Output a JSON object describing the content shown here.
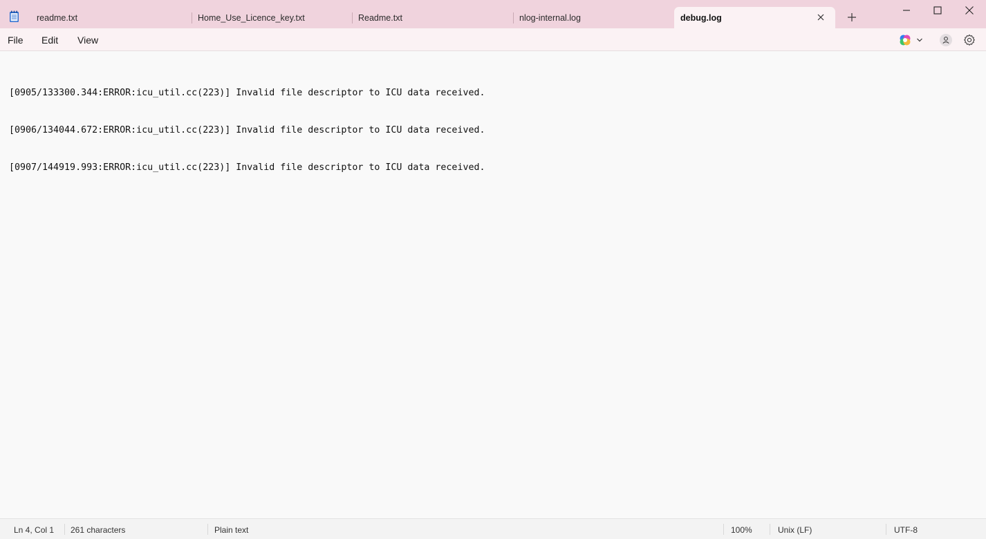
{
  "tabs": [
    {
      "label": "readme.txt"
    },
    {
      "label": "Home_Use_Licence_key.txt"
    },
    {
      "label": "Readme.txt"
    },
    {
      "label": "nlog-internal.log"
    },
    {
      "label": "debug.log"
    }
  ],
  "active_tab_index": 4,
  "menu": {
    "file": "File",
    "edit": "Edit",
    "view": "View"
  },
  "editor": {
    "lines": [
      "[0905/133300.344:ERROR:icu_util.cc(223)] Invalid file descriptor to ICU data received.",
      "[0906/134044.672:ERROR:icu_util.cc(223)] Invalid file descriptor to ICU data received.",
      "[0907/144919.993:ERROR:icu_util.cc(223)] Invalid file descriptor to ICU data received."
    ]
  },
  "status": {
    "position": "Ln 4, Col 1",
    "characters": "261 characters",
    "format": "Plain text",
    "zoom": "100%",
    "line_ending": "Unix (LF)",
    "encoding": "UTF-8"
  },
  "colors": {
    "titlebar": "#f0d3dd",
    "menubar": "#fbf2f4",
    "editor_bg": "#f9f9f9"
  },
  "icons": [
    "notepad-app-icon",
    "close-icon",
    "plus-icon",
    "minimize-icon",
    "maximize-icon",
    "window-close-icon",
    "copilot-icon",
    "chevron-down-icon",
    "account-icon",
    "gear-icon"
  ]
}
